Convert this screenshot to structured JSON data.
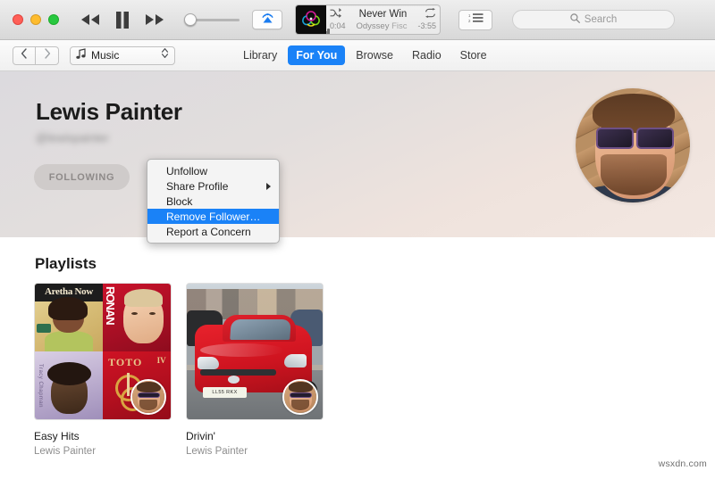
{
  "window": {
    "traffic_lights": [
      "close",
      "minimize",
      "zoom"
    ]
  },
  "toolbar": {
    "rewind_icon": "rewind-icon",
    "play_pause_icon": "pause-icon",
    "fastforward_icon": "fast-forward-icon",
    "volume_icon": "volume-slider",
    "airplay_icon": "airplay-icon",
    "list_icon": "up-next-list-icon",
    "search": {
      "placeholder": "Search",
      "icon": "search-icon"
    }
  },
  "now_playing": {
    "title": "Never Win",
    "artist": "Odyssey",
    "album": "Fisc",
    "elapsed": "0:04",
    "remaining": "-3:55",
    "shuffle_icon": "shuffle-icon",
    "repeat_icon": "repeat-icon",
    "artwork_icon": "album-artwork",
    "progress_percent": 2
  },
  "navbar": {
    "back_icon": "chevron-left-icon",
    "forward_icon": "chevron-right-icon",
    "source": {
      "label": "Music",
      "icon": "music-note-icon",
      "chevron_icon": "chevron-updown-icon"
    },
    "tabs": [
      {
        "label": "Library",
        "active": false
      },
      {
        "label": "For You",
        "active": true
      },
      {
        "label": "Browse",
        "active": false
      },
      {
        "label": "Radio",
        "active": false
      },
      {
        "label": "Store",
        "active": false
      }
    ]
  },
  "profile": {
    "name": "Lewis Painter",
    "handle": "@lewispainter",
    "follow_button": "FOLLOWING",
    "avatar_alt": "profile-photo"
  },
  "context_menu": {
    "items": [
      {
        "label": "Unfollow",
        "highlight": false,
        "submenu": false
      },
      {
        "label": "Share Profile",
        "highlight": false,
        "submenu": true
      },
      {
        "label": "Block",
        "highlight": false,
        "submenu": false
      },
      {
        "label": "Remove Follower…",
        "highlight": true,
        "submenu": false
      },
      {
        "label": "Report a Concern",
        "highlight": false,
        "submenu": false
      }
    ]
  },
  "playlists_section": {
    "title": "Playlists",
    "items": [
      {
        "title": "Easy Hits",
        "owner": "Lewis Painter",
        "artwork_type": "collage",
        "covers": [
          "Aretha Now",
          "RONAN",
          "Tracy Chapman",
          "TOTO IV"
        ]
      },
      {
        "title": "Drivin'",
        "owner": "Lewis Painter",
        "artwork_type": "photo",
        "covers": [
          "red car photo"
        ]
      }
    ]
  },
  "colors": {
    "accent": "#1a82f7",
    "header_gradient_start": "#dcdade",
    "header_gradient_end": "#f3e7e1",
    "menu_highlight": "#1a82f7"
  },
  "watermark": "wsxdn.com"
}
